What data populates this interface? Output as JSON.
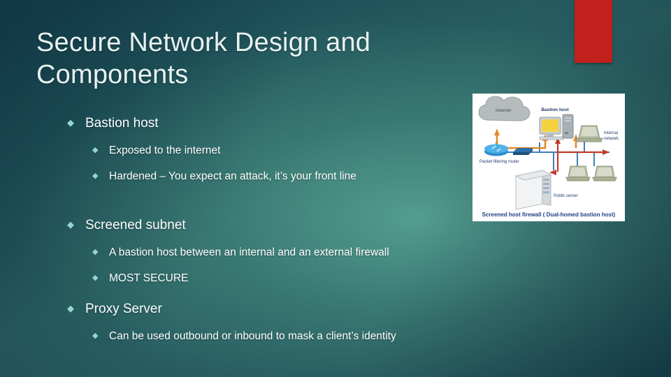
{
  "slide": {
    "title": "Secure Network Design and Components",
    "background_colors": {
      "dark_teal": "#15424f",
      "mid_teal": "#2c6466",
      "light_teal": "#56a091"
    },
    "accent_bar_color": "#c1201c",
    "bullet_color": "#93d5d3",
    "text_color": "#ffffff",
    "title_color": "#e9f2f0"
  },
  "bullets": {
    "marker": "◆",
    "items": [
      {
        "level": 1,
        "label": "Bastion host"
      },
      {
        "level": 2,
        "label": "Exposed to the internet"
      },
      {
        "level": 2,
        "label": "Hardened – You expect an attack, it’s your front line"
      },
      {
        "level": 1,
        "label": "Screened subnet"
      },
      {
        "level": 2,
        "label": "A bastion host between an internal and an external firewall"
      },
      {
        "level": 2,
        "label": "MOST SECURE"
      },
      {
        "level": 1,
        "label": "Proxy Server"
      },
      {
        "level": 2,
        "label": "Can be used outbound or inbound to mask a client’s identity"
      }
    ]
  },
  "diagram": {
    "caption": "Screened host firewall ( Dual-homed bastion host)",
    "labels": {
      "internet": "Internet",
      "bastion_host": "Bastion host",
      "packet_filtering_router": "Packet filtering router",
      "public_server": "Public server",
      "internal_network_line1": "Internal",
      "internal_network_line2": "network"
    },
    "colors": {
      "cloud": "#b6bcbd",
      "caption": "#1f3f86",
      "label": "#203a6b",
      "link_blue": "#3e7fb5",
      "arrow_orange": "#e08a28",
      "arrow_red": "#c0392b",
      "monitor_screen": "#f6d243"
    }
  }
}
